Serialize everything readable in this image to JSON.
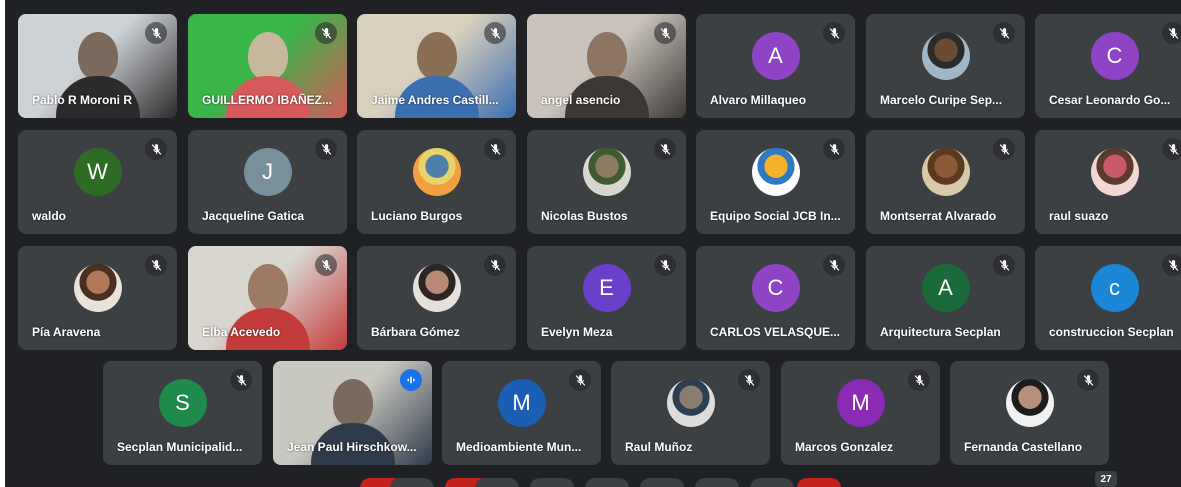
{
  "participants": [
    {
      "name": "Pablo R Moroni R",
      "type": "video",
      "muted": true,
      "palette": [
        "#cdd2d6",
        "#7b6a5c",
        "#2d2a2b"
      ]
    },
    {
      "name": "GUILLERMO IBAÑEZ...",
      "type": "video",
      "muted": true,
      "palette": [
        "#39b54a",
        "#c7b79c",
        "#d65a5a"
      ]
    },
    {
      "name": "Jaime Andres Castill...",
      "type": "video",
      "muted": true,
      "palette": [
        "#d9cfbd",
        "#8a6f55",
        "#3a6fb0"
      ]
    },
    {
      "name": "angel asencio",
      "type": "video",
      "muted": true,
      "palette": [
        "#c9c3bb",
        "#8c7563",
        "#3b3835"
      ]
    },
    {
      "name": "Alvaro Millaqueo",
      "type": "avatar",
      "initial": "A",
      "color": "#8e44c4",
      "muted": true
    },
    {
      "name": "Marcelo Curipe Sep...",
      "type": "photo",
      "muted": true,
      "palette": [
        "#9fb7c9",
        "#6b4b34",
        "#2b2b2b"
      ]
    },
    {
      "name": "Cesar Leonardo Go...",
      "type": "avatar",
      "initial": "C",
      "color": "#8e44c4",
      "muted": true
    },
    {
      "name": "waldo",
      "type": "avatar",
      "initial": "W",
      "color": "#2e6b24",
      "muted": true
    },
    {
      "name": "Jacqueline Gatica",
      "type": "avatar",
      "initial": "J",
      "color": "#78909c",
      "muted": true
    },
    {
      "name": "Luciano Burgos",
      "type": "photo",
      "muted": true,
      "palette": [
        "#f0a040",
        "#4e7fa8",
        "#e8d36a"
      ]
    },
    {
      "name": "Nicolas Bustos",
      "type": "photo",
      "muted": true,
      "palette": [
        "#d7d7cf",
        "#8d7a62",
        "#3e5c2f"
      ]
    },
    {
      "name": "Equipo Social JCB In...",
      "type": "photo",
      "muted": true,
      "palette": [
        "#ffffff",
        "#f5b02c",
        "#2f78c4"
      ]
    },
    {
      "name": "Montserrat Alvarado",
      "type": "photo",
      "muted": true,
      "palette": [
        "#d8c9a8",
        "#8b5a36",
        "#5b3a21"
      ]
    },
    {
      "name": "raul suazo",
      "type": "photo",
      "muted": true,
      "palette": [
        "#f3d7d3",
        "#c75a68",
        "#5b3b2c"
      ]
    },
    {
      "name": "Pía Aravena",
      "type": "photo",
      "muted": true,
      "palette": [
        "#e9e2d8",
        "#b07a5a",
        "#4a2f22"
      ]
    },
    {
      "name": "Elba Acevedo",
      "type": "video",
      "muted": true,
      "palette": [
        "#d9d6cf",
        "#9c7b66",
        "#c43b3b"
      ]
    },
    {
      "name": "Bárbara Gómez",
      "type": "photo",
      "muted": true,
      "palette": [
        "#e6e0da",
        "#b98a73",
        "#2d2424"
      ]
    },
    {
      "name": "Evelyn Meza",
      "type": "avatar",
      "initial": "E",
      "color": "#6a3fc9",
      "muted": true
    },
    {
      "name": "CARLOS VELASQUE...",
      "type": "avatar",
      "initial": "C",
      "color": "#8e44c4",
      "muted": true
    },
    {
      "name": "Arquitectura Secplan",
      "type": "avatar",
      "initial": "A",
      "color": "#1b6b3a",
      "muted": true
    },
    {
      "name": "construccion Secplan",
      "type": "avatar",
      "initial": "c",
      "color": "#1a88d6",
      "muted": true
    },
    {
      "name": "Secplan Municipalid...",
      "type": "avatar",
      "initial": "S",
      "color": "#1e8a4c",
      "muted": true
    },
    {
      "name": "Jean Paul Hirschkow...",
      "type": "video",
      "muted": false,
      "speaking": true,
      "palette": [
        "#c8c8c0",
        "#7a6a5e",
        "#2f3a4a"
      ]
    },
    {
      "name": "Medioambiente Mun...",
      "type": "avatar",
      "initial": "M",
      "color": "#1a5fb4",
      "muted": true
    },
    {
      "name": "Raul Muñoz",
      "type": "photo",
      "muted": true,
      "palette": [
        "#dcdcdc",
        "#8a7c70",
        "#2c3e50"
      ]
    },
    {
      "name": "Marcos Gonzalez",
      "type": "avatar",
      "initial": "M",
      "color": "#8a2ab5",
      "muted": true
    },
    {
      "name": "Fernanda Castellano",
      "type": "photo",
      "muted": true,
      "palette": [
        "#f1f1f1",
        "#b88f79",
        "#1c1c1c"
      ]
    }
  ],
  "participant_count": "27",
  "icons": {
    "muted": "mic-off-icon",
    "speaking": "audio-wave-icon"
  }
}
